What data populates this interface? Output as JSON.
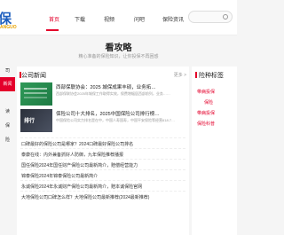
{
  "logo": {
    "brand": "保",
    "tagline": "ANGUO"
  },
  "nav": {
    "items": [
      {
        "label": "首页"
      },
      {
        "label": "下载"
      },
      {
        "label": "视频"
      },
      {
        "label": "问吧"
      },
      {
        "label": "保险资讯"
      }
    ]
  },
  "search": {
    "placeholder": "保险资讯..."
  },
  "hero": {
    "title": "看攻略",
    "subtitle": "精心准备的保险知识，让你投保不再困惑"
  },
  "sidebar": {
    "items": [
      {
        "label": "司"
      },
      {
        "label": "新闻"
      },
      {
        "label": "读"
      },
      {
        "label": "保"
      },
      {
        "label": "险"
      }
    ]
  },
  "main": {
    "section_title": "公司新闻",
    "more": "更多 >",
    "features": [
      {
        "title": "西部保联协会：2025 城保成果丰硕，业务拓…",
        "desc": "西部保联协会2025年城保工作取得实效，保费增幅居西部前列，业务……",
        "thumb": "news"
      },
      {
        "title": "保险公司十大排名，2025中国保险公司排行榜…",
        "desc": "中国保险公司实力排名是在中，中国人寿国寿，中国平安保险等经营618.7…",
        "thumb": "排行"
      }
    ],
    "list": [
      "口碑最好的保险公司是哪家？2024口碑最好保险公司排名",
      "泰康在线：内外兼备抓好人防御，九年保险推荐播报",
      "国任保险2024年国任财产保险公司最新简介，赔偿经营能力",
      "锦泰保险2024年锦泰保险公司最新简介",
      "永诚保险2024年永诚财产保险公司最新简介，赔本诚保险官网",
      "大地保险公司口碑怎么样？大地保险公司最新推荐(2024最新推荐)"
    ]
  },
  "right": {
    "title": "险种标签",
    "items": [
      {
        "label": "带病投保"
      },
      {
        "label": "保险"
      },
      {
        "label": "带病投保"
      },
      {
        "label": "保险科普"
      }
    ]
  }
}
